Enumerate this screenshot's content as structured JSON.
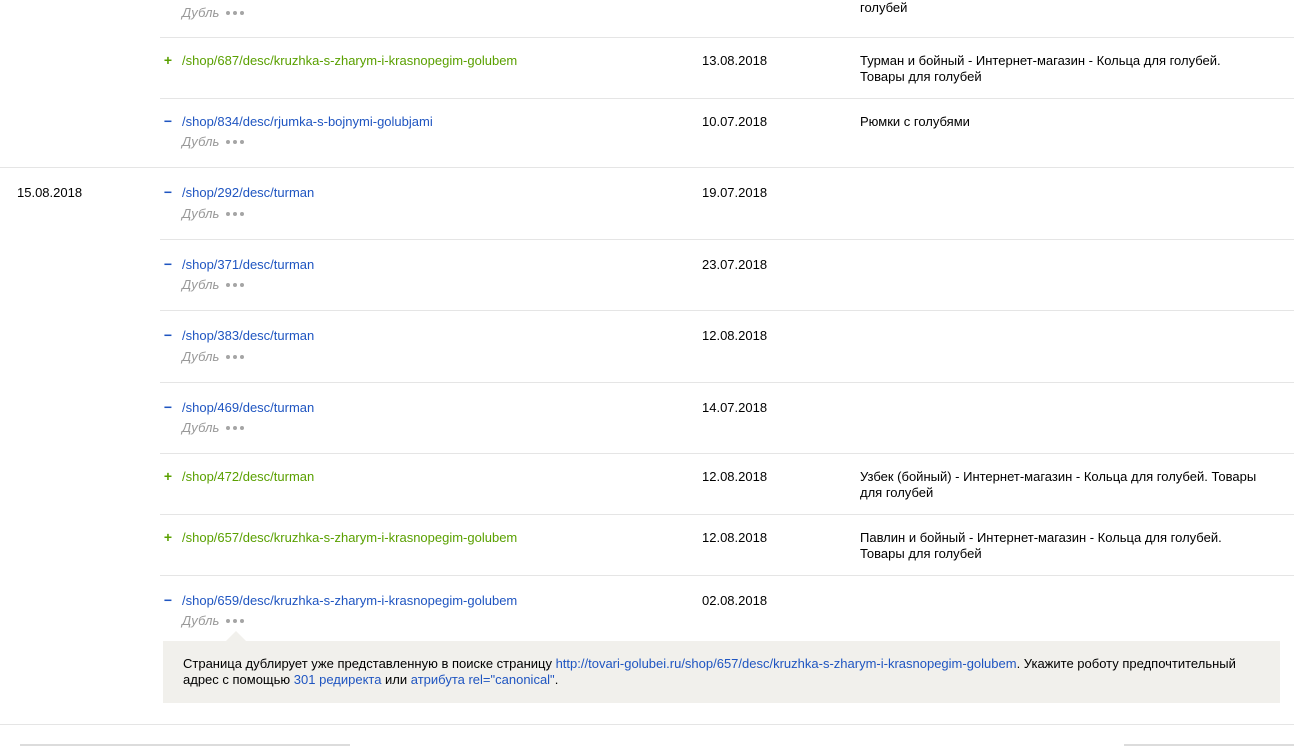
{
  "dup_label": "Дубль",
  "prev_group": {
    "top_title_tail": "голубей",
    "rows": [
      {
        "sign": "+",
        "url": "/shop/687/desc/kruzhka-s-zharym-i-krasnopegim-golubem",
        "date": "13.08.2018",
        "title": "Турман и бойный - Интернет-магазин - Кольца для голубей. Товары для голубей"
      },
      {
        "sign": "−",
        "url": "/shop/834/desc/rjumka-s-bojnymi-golubjami",
        "date": "10.07.2018",
        "title": "Рюмки с голубями"
      }
    ]
  },
  "group": {
    "date": "15.08.2018",
    "rows": [
      {
        "sign": "−",
        "url": "/shop/292/desc/turman",
        "date": "19.07.2018",
        "title": ""
      },
      {
        "sign": "−",
        "url": "/shop/371/desc/turman",
        "date": "23.07.2018",
        "title": ""
      },
      {
        "sign": "−",
        "url": "/shop/383/desc/turman",
        "date": "12.08.2018",
        "title": ""
      },
      {
        "sign": "−",
        "url": "/shop/469/desc/turman",
        "date": "14.07.2018",
        "title": ""
      },
      {
        "sign": "+",
        "url": "/shop/472/desc/turman",
        "date": "12.08.2018",
        "title": "Узбек (бойный) - Интернет-магазин - Кольца для голубей. Товары для голубей"
      },
      {
        "sign": "+",
        "url": "/shop/657/desc/kruzhka-s-zharym-i-krasnopegim-golubem",
        "date": "12.08.2018",
        "title": "Павлин и бойный - Интернет-магазин - Кольца для голубей. Товары для голубей"
      },
      {
        "sign": "−",
        "url": "/shop/659/desc/kruzhka-s-zharym-i-krasnopegim-golubem",
        "date": "02.08.2018",
        "title": ""
      }
    ]
  },
  "tooltip": {
    "text1": "Страница дублирует уже представленную в поиске страницу ",
    "link_url": "http://tovari-golubei.ru/shop/657/desc/kruzhka-s-zharym-i-krasnopegim-golubem",
    "text2": ". Укажите роботу предпочтительный адрес с помощью ",
    "link_301": "301 редиректа",
    "text3": " или ",
    "link_canonical": "атрибута rel=\"canonical\"",
    "text4": "."
  },
  "colors": {
    "green": "#5aa000",
    "blue": "#1f55c1",
    "muted": "#999999",
    "tooltip_bg": "#f1f0ec"
  }
}
